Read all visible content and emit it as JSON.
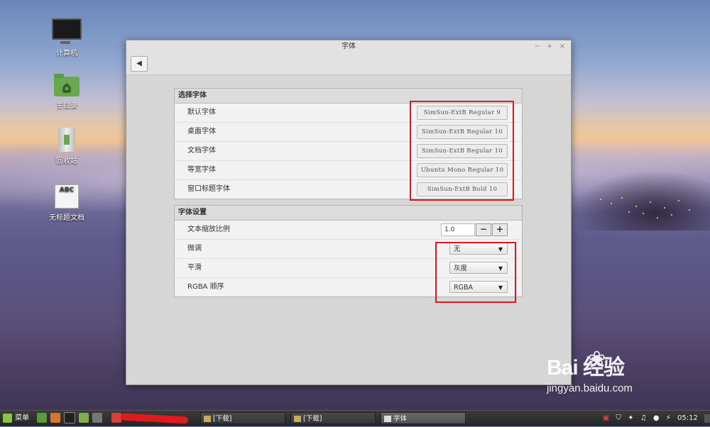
{
  "desktop": {
    "icons": [
      {
        "label": "计算机",
        "icon": "computer-icon"
      },
      {
        "label": "主目录",
        "icon": "home-folder-icon"
      },
      {
        "label": "回收站",
        "icon": "trash-icon"
      },
      {
        "label": "无标题文档",
        "icon": "text-document-icon",
        "badge": "ABC"
      }
    ]
  },
  "window": {
    "title": "字体",
    "controls": {
      "minimize": "−",
      "maximize": "+",
      "close": "×"
    },
    "back_icon": "◀",
    "font_select": {
      "heading": "选择字体",
      "rows": [
        {
          "label": "默认字体",
          "value": "SimSun-ExtB Regular   9"
        },
        {
          "label": "桌面字体",
          "value": "SimSun-ExtB Regular   10"
        },
        {
          "label": "文档字体",
          "value": "SimSun-ExtB Regular   10"
        },
        {
          "label": "等宽字体",
          "value": "Ubuntu Mono Regular   10"
        },
        {
          "label": "窗口标题字体",
          "value": "SimSun-ExtB Bold   10"
        }
      ]
    },
    "font_settings": {
      "heading": "字体设置",
      "scale": {
        "label": "文本缩放比例",
        "value": "1.0",
        "minus": "−",
        "plus": "+"
      },
      "hinting": {
        "label": "微调",
        "value": "无"
      },
      "antialias": {
        "label": "平滑",
        "value": "灰度"
      },
      "rgba": {
        "label": "RGBA 顺序",
        "value": "RGBA"
      }
    }
  },
  "taskbar": {
    "menu_label": "菜单",
    "tasks": [
      {
        "label": "[下载]",
        "active": false
      },
      {
        "label": "[下载]",
        "active": false
      },
      {
        "label": "字体",
        "active": true
      }
    ],
    "clock": "05:12"
  },
  "watermark": {
    "brand": "Bai  经验",
    "url": "jingyan.baidu.com"
  },
  "colors": {
    "highlight_box": "#e0191e",
    "mint_green": "#8bc34a"
  }
}
